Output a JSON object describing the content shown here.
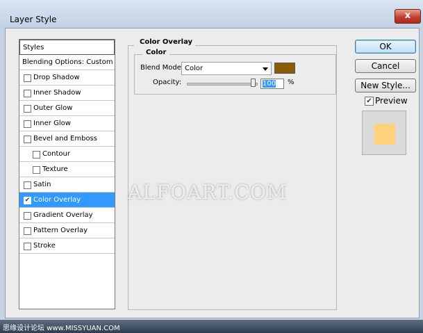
{
  "window": {
    "title": "Layer Style",
    "close_glyph": "x"
  },
  "styles_panel": {
    "header": "Styles",
    "blending": "Blending Options: Custom",
    "items": [
      {
        "label": "Drop Shadow",
        "checked": false,
        "indent": false,
        "selected": false
      },
      {
        "label": "Inner Shadow",
        "checked": false,
        "indent": false,
        "selected": false
      },
      {
        "label": "Outer Glow",
        "checked": false,
        "indent": false,
        "selected": false
      },
      {
        "label": "Inner Glow",
        "checked": false,
        "indent": false,
        "selected": false
      },
      {
        "label": "Bevel and Emboss",
        "checked": false,
        "indent": false,
        "selected": false
      },
      {
        "label": "Contour",
        "checked": false,
        "indent": true,
        "selected": false
      },
      {
        "label": "Texture",
        "checked": false,
        "indent": true,
        "selected": false
      },
      {
        "label": "Satin",
        "checked": false,
        "indent": false,
        "selected": false
      },
      {
        "label": "Color Overlay",
        "checked": true,
        "indent": false,
        "selected": true
      },
      {
        "label": "Gradient Overlay",
        "checked": false,
        "indent": false,
        "selected": false
      },
      {
        "label": "Pattern Overlay",
        "checked": false,
        "indent": false,
        "selected": false
      },
      {
        "label": "Stroke",
        "checked": false,
        "indent": false,
        "selected": false
      }
    ]
  },
  "color_overlay": {
    "group_title": "Color Overlay",
    "sub_title": "Color",
    "blend_mode_label": "Blend Mode:",
    "blend_mode_value": "Color",
    "overlay_color": "#8a5c06",
    "opacity_label": "Opacity:",
    "opacity_value": "100",
    "opacity_unit": "%",
    "opacity_fraction": 1.0
  },
  "buttons": {
    "ok": "OK",
    "cancel": "Cancel",
    "new_style": "New Style..."
  },
  "preview": {
    "label": "Preview",
    "checked": true,
    "swatch_color": "#ffd27a"
  },
  "watermark": "ALFOART.COM",
  "footer_text": "思缘设计论坛 www.MISSYUAN.COM"
}
